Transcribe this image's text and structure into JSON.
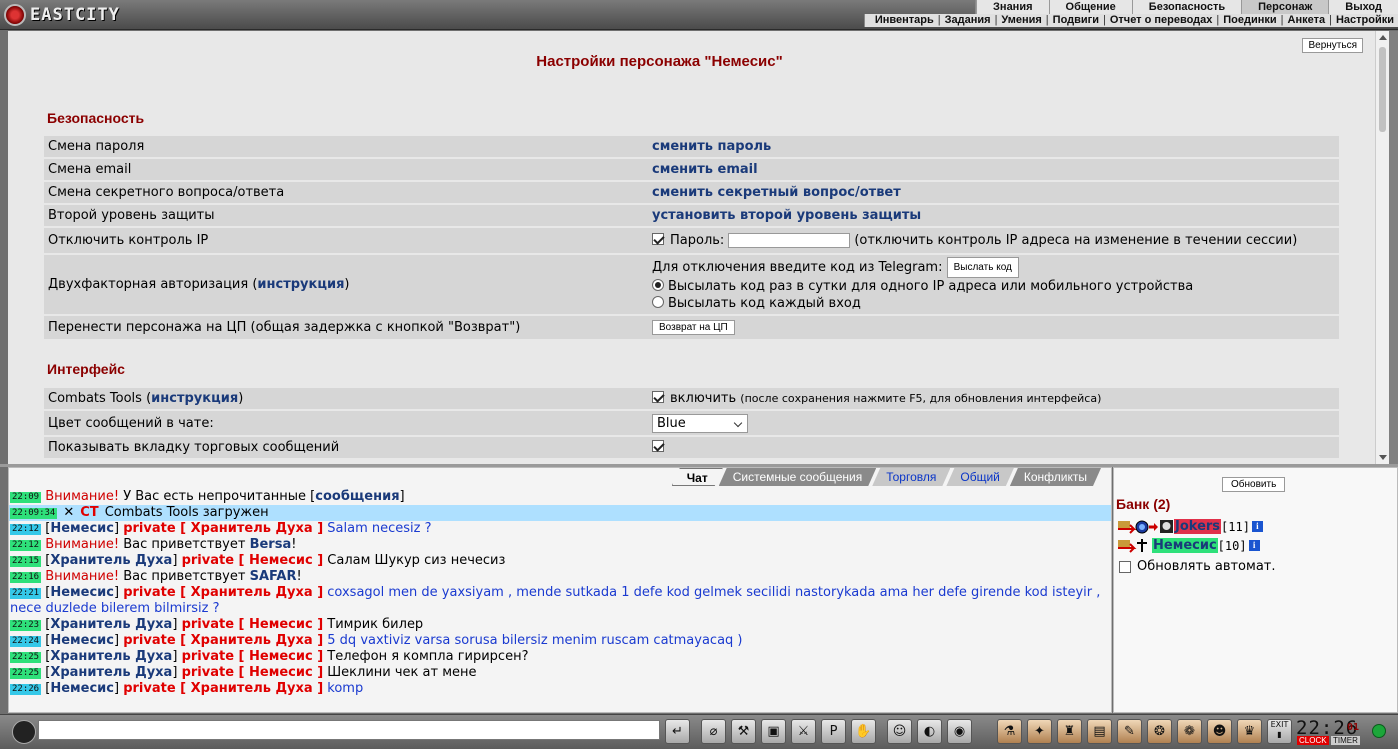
{
  "header": {
    "logo_text": "EASTCITY",
    "nav_top": [
      {
        "label": "Знания",
        "active": false
      },
      {
        "label": "Общение",
        "active": false
      },
      {
        "label": "Безопасность",
        "active": false
      },
      {
        "label": "Персонаж",
        "active": true
      },
      {
        "label": "Выход",
        "active": false
      }
    ],
    "nav_sub": [
      "Инвентарь",
      "Задания",
      "Умения",
      "Подвиги",
      "Отчет о переводах",
      "Поединки",
      "Анкета",
      "Настройки"
    ]
  },
  "settings": {
    "back_button": "Вернуться",
    "page_title": "Настройки персонажа \"Немесис\"",
    "security": {
      "title": "Безопасность",
      "rows": {
        "change_password": {
          "label": "Смена пароля",
          "link": "сменить пароль"
        },
        "change_email": {
          "label": "Смена email",
          "link": "сменить email"
        },
        "change_secret": {
          "label": "Смена секретного вопроса/ответа",
          "link": "сменить секретный вопрос/ответ"
        },
        "second_level": {
          "label": "Второй уровень защиты",
          "link": "установить второй уровень защиты"
        },
        "ip_control": {
          "label": "Отключить контроль IP",
          "checked": true,
          "password_label": "Пароль:",
          "note": "(отключить контроль IP адреса на изменение в течении сессии)"
        },
        "two_factor": {
          "label_prefix": "Двухфакторная авторизация (",
          "label_link": "инструкция",
          "label_suffix": ")",
          "telegram_text": "Для отключения введите код из Telegram:",
          "send_code_button": "Выслать код",
          "option_once": "Высылать код раз в сутки для одного IP адреса или мобильного устройства",
          "option_each": "Высылать код каждый вход",
          "selected": "once"
        },
        "move_to_cp": {
          "label": "Перенести персонажа на ЦП (общая задержка с кнопкой \"Возврат\")",
          "button": "Возврат на ЦП"
        }
      }
    },
    "interface": {
      "title": "Интерфейс",
      "rows": {
        "combats_tools": {
          "label_prefix": "Combats Tools (",
          "label_link": "инструкция",
          "label_suffix": ")",
          "checked": true,
          "enable_label": "включить",
          "note": "(после сохранения нажмите F5, для обновления интерфейса)"
        },
        "chat_color": {
          "label": "Цвет сообщений в чате:",
          "value": "Blue"
        },
        "trade_tab": {
          "label": "Показывать вкладку торговых сообщений",
          "checked": true
        }
      }
    }
  },
  "chat": {
    "tabs": [
      {
        "label": "Чат",
        "style": "active"
      },
      {
        "label": "Системные сообщения",
        "style": "normal"
      },
      {
        "label": "Торговля",
        "style": "blue"
      },
      {
        "label": "Общий",
        "style": "blue"
      },
      {
        "label": "Конфликты",
        "style": "normal"
      }
    ],
    "lines": {
      "l1": {
        "time": "22:09",
        "warn": "Внимание!",
        "text": "У Вас есть непрочитанные [",
        "link": "сообщения",
        "tail": "]"
      },
      "l2": {
        "time": "22:09:34",
        "x": "✕",
        "ct": "CT",
        "text": "Combats Tools загружен"
      },
      "l3": {
        "time": "22:12",
        "from": "Немесис",
        "priv": "private [ Хранитель Духа ]",
        "msg": "Salam necesiz ?"
      },
      "l4": {
        "time": "22:12",
        "warn": "Внимание!",
        "text": "Вас приветствует",
        "who": "Bersa",
        "tail": "!"
      },
      "l5": {
        "time": "22:15",
        "from": "Хранитель Духа",
        "priv": "private [ Немесис ]",
        "msg": "Салам Шукур сиз нечесиз"
      },
      "l6": {
        "time": "22:16",
        "warn": "Внимание!",
        "text": "Вас приветствует",
        "who": "SAFAR",
        "tail": "!"
      },
      "l7": {
        "time": "22:21",
        "from": "Немесис",
        "priv": "private [ Хранитель Духа ]",
        "msg": "coxsagol men de yaxsiyam , mende sutkada 1 defe kod gelmek secilidi nastorykada ama her defe girende kod isteyir , nece duzlede bilerem bilmirsiz ?"
      },
      "l8": {
        "time": "22:23",
        "from": "Хранитель Духа",
        "priv": "private [ Немесис ]",
        "msg": "Тимрик билер"
      },
      "l9": {
        "time": "22:24",
        "from": "Немесис",
        "priv": "private [ Хранитель Духа ]",
        "msg": "5 dq vaxtiviz varsa sorusa bilersiz menim ruscam catmayacaq )"
      },
      "l10": {
        "time": "22:25",
        "from": "Хранитель Духа",
        "priv": "private [ Немесис ]",
        "msg": "Телефон я компла гирирсен?"
      },
      "l11": {
        "time": "22:25",
        "from": "Хранитель Духа",
        "priv": "private [ Немесис ]",
        "msg": "Шеклини чек ат мене"
      },
      "l12": {
        "time": "22:26",
        "from": "Немесис",
        "priv": "private [ Хранитель Духа ]",
        "msg": "komp"
      }
    }
  },
  "room": {
    "refresh_button": "Обновить",
    "title": "Банк (2)",
    "users": [
      {
        "name": "Jokers",
        "level": "[11]",
        "highlight": "#e0304a"
      },
      {
        "name": "Немесис",
        "level": "[10]",
        "highlight": "#2ee07a"
      }
    ],
    "auto_refresh_label": "Обновлять автомат.",
    "auto_refresh_checked": false
  },
  "bottom": {
    "clock_time": "22:26",
    "clock_seconds": "01",
    "clock_label": "CLOCK",
    "timer_label": "TIMER",
    "icons": [
      "enter-icon",
      "bandage-icon",
      "hammer-icon",
      "bag-icon",
      "fighter-icon",
      "pl-icon",
      "hand-icon",
      "smiley-icon",
      "helmet-icon",
      "ring-icon",
      "flask-icon",
      "sword-icon",
      "sack-icon",
      "chest-icon",
      "scroll-icon",
      "brain-icon",
      "medallion-icon",
      "group-icon",
      "exit-door-icon"
    ],
    "exit_label": "EXIT"
  }
}
